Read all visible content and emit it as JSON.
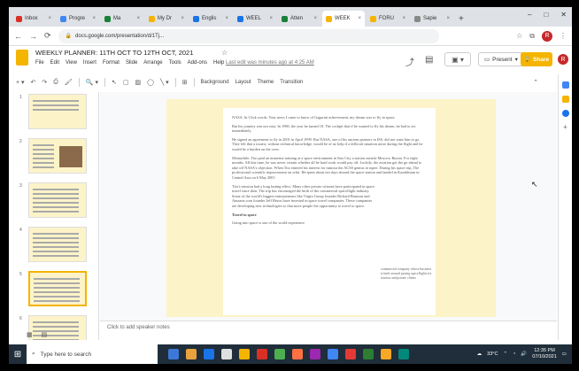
{
  "browser": {
    "tabs": [
      {
        "label": "Inbox",
        "color": "#d93025"
      },
      {
        "label": "Progre",
        "color": "#4285f4"
      },
      {
        "label": "Ma",
        "color": "#188038"
      },
      {
        "label": "My Dr",
        "color": "#f4b400"
      },
      {
        "label": "Englis",
        "color": "#1a73e8"
      },
      {
        "label": "WEEL",
        "color": "#1a73e8"
      },
      {
        "label": "Atten",
        "color": "#188038"
      },
      {
        "label": "WEEK",
        "color": "#f4b400",
        "active": true
      },
      {
        "label": "FORU",
        "color": "#f4b400"
      },
      {
        "label": "Sapie",
        "color": "#888888"
      }
    ],
    "new_tab": "+",
    "url": "docs.google.com/presentation/d/1Tj...",
    "window_controls": [
      "–",
      "□",
      "✕"
    ],
    "profile_initial": "R"
  },
  "slides": {
    "title": "WEEKLY PLANNER: 11TH OCT TO 12TH OCT, 2021",
    "menu": [
      "File",
      "Edit",
      "View",
      "Insert",
      "Format",
      "Slide",
      "Arrange",
      "Tools",
      "Add-ons",
      "Help"
    ],
    "last_edit": "Last edit was minutes ago at 4:25 AM",
    "present_label": "Present",
    "share_label": "Share",
    "user_initial": "R",
    "toolbar": {
      "background": "Background",
      "layout": "Layout",
      "theme": "Theme",
      "transition": "Transition"
    },
    "speaker_notes": "Click to add speaker notes"
  },
  "filmstrip": {
    "slides": [
      {
        "num": "1"
      },
      {
        "num": "2"
      },
      {
        "num": "3"
      },
      {
        "num": "4"
      },
      {
        "num": "5",
        "selected": true
      },
      {
        "num": "6"
      }
    ]
  },
  "slide_text": {
    "paragraphs": [
      "NASA. In Click words. Your news I came to know of Gagarini achievement, my dream was to fly in space.",
      "But his journey was not easy. In 1980, the year he turned 18. The cockpit that if he wanted to fly his dream, he had to act immediately.",
      "He signed an agreement to fly in 2001 in April 1999. But NASA, one of his ancient partners in ISS, did not want him to go. They felt that a tourist, without technical knowledge, would be of no help if a difficult situation arose during the flight and he would be a burden on the crew.",
      "Meanwhile, Tito paid an immense training at a space environment in Star City a station outside Moscow Russia. For eight months. All this time, he was never certain whether all he hard work would pay off. Luckily, the aviation got the go-ahead to take off NASA's objection. When Tito entered his interest for rumour the ACSS genius in rupee. During his space trip, The professional scientific improvement on orbit. He spent about ten days aboard the space station and landed in Kazakhstan in Central Asia on 6 May 2001.",
      "Tito's mission had a long lasting effect. Many other private citizens have participated in space travel since then. The trip has encouraged the birth of the commercial spaceflight industry. Some of the world's biggest entrepreneurs like Virgin Group founder Richard Branson and Amazon.com founder Jeff Bezos have invested in space travel companies. These companies are developing new technologies so that more people the opportunity to travel to space.",
      "Travel to space",
      "Going into space is one of the world experience"
    ],
    "margin_note": "commercial company whose business is built around paying spaceflights for tourists and private clients"
  },
  "taskbar": {
    "search_placeholder": "Type here to search",
    "temperature": "33°C",
    "time": "12:35 PM",
    "date": "07/10/2021",
    "apps": [
      "#3c78d8",
      "#e8a33d",
      "#1a73e8",
      "#e0e0e0",
      "#f4b400",
      "#d93025",
      "#4caf50",
      "#ff7043",
      "#9c27b0",
      "#4285f4",
      "#e53935",
      "#2e7d32",
      "#f9a825",
      "#00897b"
    ]
  }
}
